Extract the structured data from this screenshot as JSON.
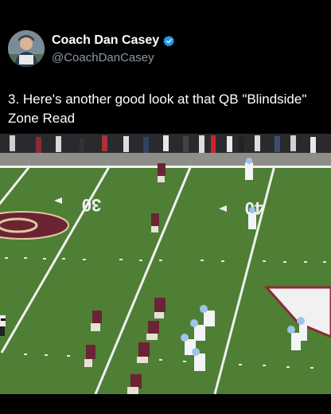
{
  "tweet": {
    "display_name": "Coach Dan Casey",
    "handle": "@CoachDanCasey",
    "verified": true,
    "text": "3. Here's another good look at that QB \"Blindside\" Zone Read"
  },
  "icons": {
    "verified": "verified-badge-icon"
  },
  "media": {
    "yard_numbers": [
      "30",
      "40"
    ]
  },
  "colors": {
    "background": "#000000",
    "verified_blue": "#1d9bf0",
    "handle_gray": "#8b98a5",
    "field_green": "#4e7f35",
    "home_maroon": "#6b2433",
    "away_white": "#f2f4f7"
  }
}
